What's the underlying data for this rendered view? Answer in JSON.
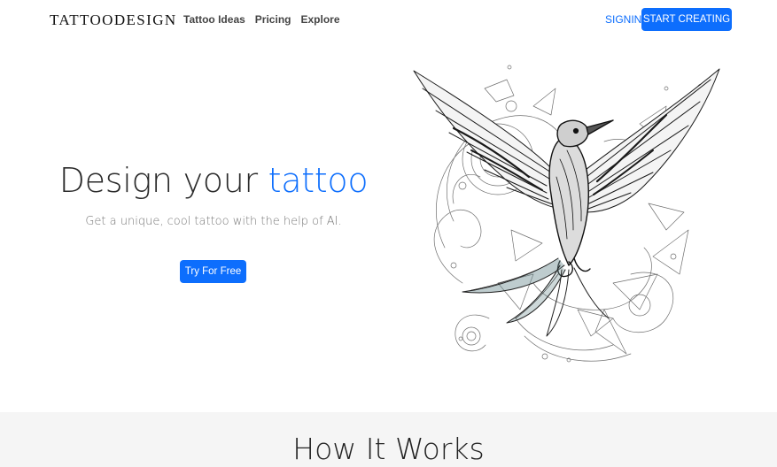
{
  "navbar": {
    "brand": "TATTOODESIGN",
    "links": [
      "Tattoo Ideas",
      "Pricing",
      "Explore"
    ],
    "signin": "SIGNIN",
    "start_creating": "START CREATING"
  },
  "hero": {
    "title_plain": "Design your ",
    "title_accent": "tattoo",
    "subtitle": "Get a unique, cool tattoo with the help of AI.",
    "cta": "Try For Free",
    "image": "bird-tattoo-illustration"
  },
  "how_it_works": {
    "title": "How It Works"
  },
  "colors": {
    "accent": "#0d6efd",
    "section_bg": "#f5f5f5"
  }
}
